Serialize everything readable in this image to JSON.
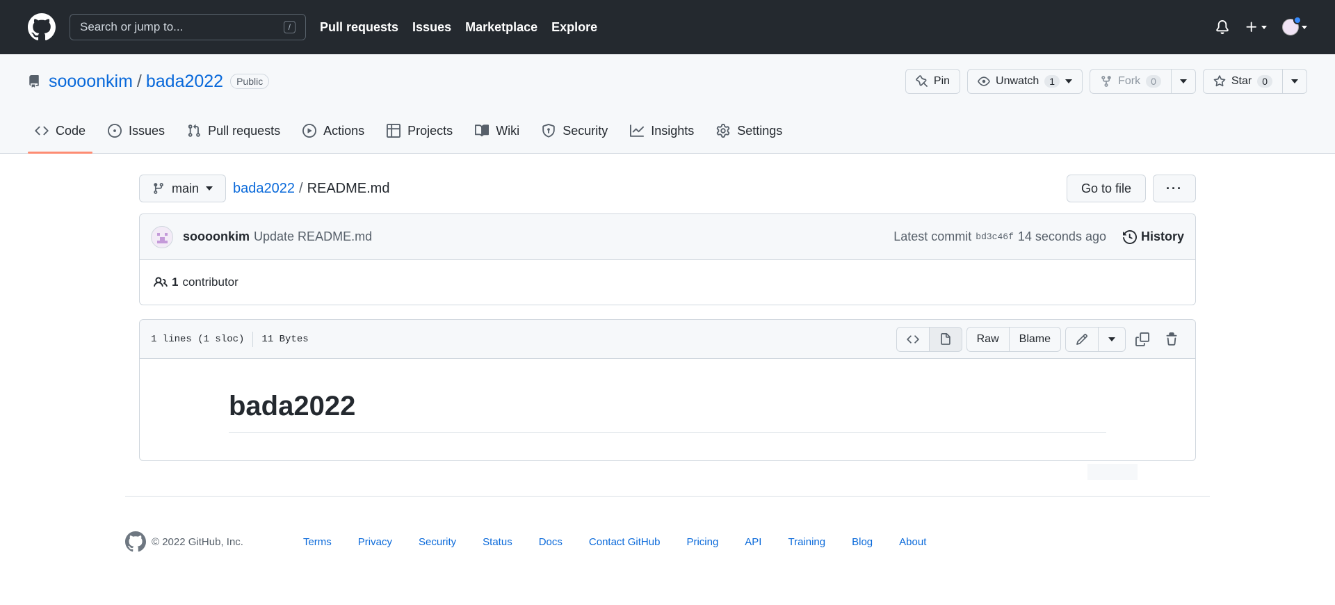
{
  "header": {
    "search_placeholder": "Search or jump to...",
    "search_shortcut": "/",
    "nav": [
      "Pull requests",
      "Issues",
      "Marketplace",
      "Explore"
    ]
  },
  "repo": {
    "owner": "soooonkim",
    "separator": "/",
    "name": "bada2022",
    "visibility": "Public",
    "actions": {
      "pin_label": "Pin",
      "unwatch_label": "Unwatch",
      "watch_count": "1",
      "fork_label": "Fork",
      "fork_count": "0",
      "star_label": "Star",
      "star_count": "0"
    },
    "tabs": [
      {
        "label": "Code",
        "icon": "code-icon",
        "active": true
      },
      {
        "label": "Issues",
        "icon": "issue-icon"
      },
      {
        "label": "Pull requests",
        "icon": "pull-request-icon"
      },
      {
        "label": "Actions",
        "icon": "play-icon"
      },
      {
        "label": "Projects",
        "icon": "table-icon"
      },
      {
        "label": "Wiki",
        "icon": "book-icon"
      },
      {
        "label": "Security",
        "icon": "shield-icon"
      },
      {
        "label": "Insights",
        "icon": "graph-icon"
      },
      {
        "label": "Settings",
        "icon": "gear-icon"
      }
    ]
  },
  "file_nav": {
    "branch": "main",
    "repo_link": "bada2022",
    "separator": "/",
    "file_name": "README.md",
    "go_to_file": "Go to file",
    "more": "···"
  },
  "commit": {
    "author": "soooonkim",
    "message": "Update README.md",
    "latest_label": "Latest commit",
    "sha": "bd3c46f",
    "time": "14 seconds ago",
    "history_label": "History",
    "contributors_count": "1",
    "contributors_label": "contributor"
  },
  "file": {
    "lines": "1 lines (1 sloc)",
    "size": "11 Bytes",
    "raw_label": "Raw",
    "blame_label": "Blame",
    "heading": "bada2022"
  },
  "footer": {
    "copyright": "© 2022 GitHub, Inc.",
    "links": [
      "Terms",
      "Privacy",
      "Security",
      "Status",
      "Docs",
      "Contact GitHub",
      "Pricing",
      "API",
      "Training",
      "Blog",
      "About"
    ]
  },
  "colors": {
    "header_bg": "#24292f",
    "link": "#0969da",
    "tab_underline": "#fd8c73"
  }
}
